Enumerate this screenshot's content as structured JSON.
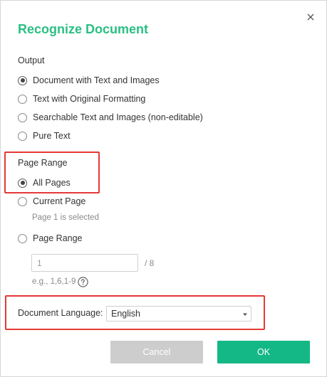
{
  "dialog": {
    "title": "Recognize Document",
    "close_icon": "close-icon"
  },
  "output": {
    "label": "Output",
    "options": [
      {
        "label": "Document with Text and Images",
        "checked": true
      },
      {
        "label": "Text with Original Formatting",
        "checked": false
      },
      {
        "label": "Searchable Text and Images (non-editable)",
        "checked": false
      },
      {
        "label": "Pure Text",
        "checked": false
      }
    ]
  },
  "page_range": {
    "label": "Page Range",
    "options": [
      {
        "label": "All Pages",
        "checked": true
      },
      {
        "label": "Current Page",
        "checked": false
      },
      {
        "label": "Page Range",
        "checked": false
      }
    ],
    "current_page_hint": "Page 1 is selected",
    "range_input_value": "1",
    "total_pages": "/ 8",
    "example_hint": "e.g., 1,6,1-9",
    "help_icon": "question-circle-icon"
  },
  "language": {
    "label": "Document Language:",
    "selected": "English",
    "dropdown_icon": "triangle-down-icon"
  },
  "buttons": {
    "cancel": "Cancel",
    "ok": "OK"
  },
  "colors": {
    "title": "#2bbf84",
    "ok_button": "#14b886",
    "cancel_button": "#cdcdcd",
    "highlight": "#e53935"
  }
}
